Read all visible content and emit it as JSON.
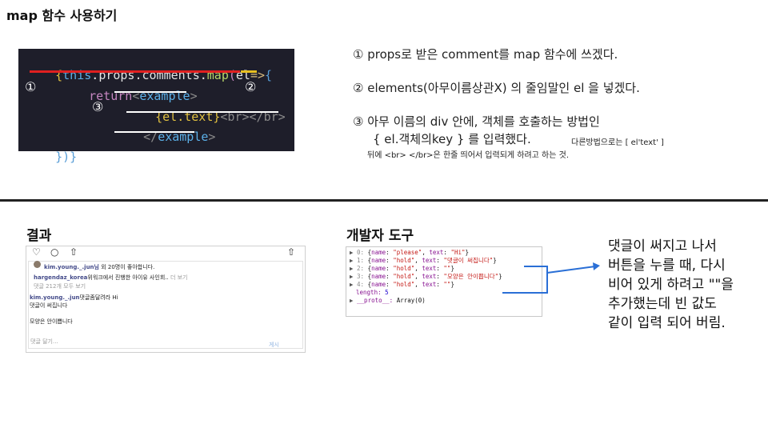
{
  "title": "map 함수 사용하기",
  "code": {
    "line1": {
      "brace_open": "{",
      "this": "this",
      "dot1": ".",
      "props": "props",
      "dot2": ".",
      "comments": "comments",
      "dot3": ".",
      "map": "map",
      "paren": "(",
      "el": "el",
      "arrow": "=>",
      "brace2": "{"
    },
    "line2": {
      "kw": "return",
      "open": "<",
      "tag": "example",
      "close": ">"
    },
    "line3": {
      "expr": "{el.text}",
      "br": "<br></br>"
    },
    "line4": {
      "open": "</",
      "tag": "example",
      "close": ">"
    },
    "line5": {
      "closing": "})}"
    },
    "markers": [
      "①",
      "②",
      "③"
    ]
  },
  "explanations": [
    "① props로 받은 comment를 map 함수에 쓰겠다.",
    "② elements(아무이름상관X) 의 줄임말인 el 을 넣겠다.",
    "③ 아무 이름의 div 안에, 객체를 호출하는 방법인",
    "{ el.객체의key } 를 입력했다.",
    "다른방법으로는 [ el'text' ]",
    "뒤에 <br> </br>은 한줄 띄어서 입력되게 하려고 하는 것."
  ],
  "result_label": "결과",
  "devtools_label": "개발자 도구",
  "instagram": {
    "likes_user": "kim.young._.jun님",
    "likes_rest": "외 20명이 좋아합니다.",
    "comment_user": "hargendaz_korea",
    "comment_text": "위워크에서 진행한 아이유 사인회..",
    "more": "더 보기",
    "view_all": "댓글 212개 모두 보기",
    "my_user": "kim.young._.jun",
    "my_comment": "댓글좀달려라 Hi",
    "extra1": "댓글이 써집니다",
    "extra2": "모양은 안이쁩니다",
    "input_placeholder": "댓글 달기...",
    "post_button": "게시"
  },
  "devtools": {
    "rows": [
      {
        "idx": "0:",
        "name": "\"please\"",
        "text": "\"Hi\""
      },
      {
        "idx": "1:",
        "name": "\"hold\"",
        "text": "\"댓글이 써집니다\""
      },
      {
        "idx": "2:",
        "name": "\"hold\"",
        "text": "\"\""
      },
      {
        "idx": "3:",
        "name": "\"hold\"",
        "text": "\"모양은 안이쁩니다\""
      },
      {
        "idx": "4:",
        "name": "\"hold\"",
        "text": "\"\""
      }
    ],
    "length_key": "length:",
    "length_val": "5",
    "proto_key": "__proto__:",
    "proto_val": "Array(0)"
  },
  "note_lines": [
    "댓글이 써지고 나서",
    "버튼을 누를 때, 다시",
    "비어 있게 하려고 \"\"을",
    "추가했는데 빈 값도",
    "같이 입력 되어 버림."
  ],
  "colors": {
    "code_bg": "#1e1e2a",
    "arrow": "#2a6fd6",
    "underline_red": "#e02020"
  }
}
